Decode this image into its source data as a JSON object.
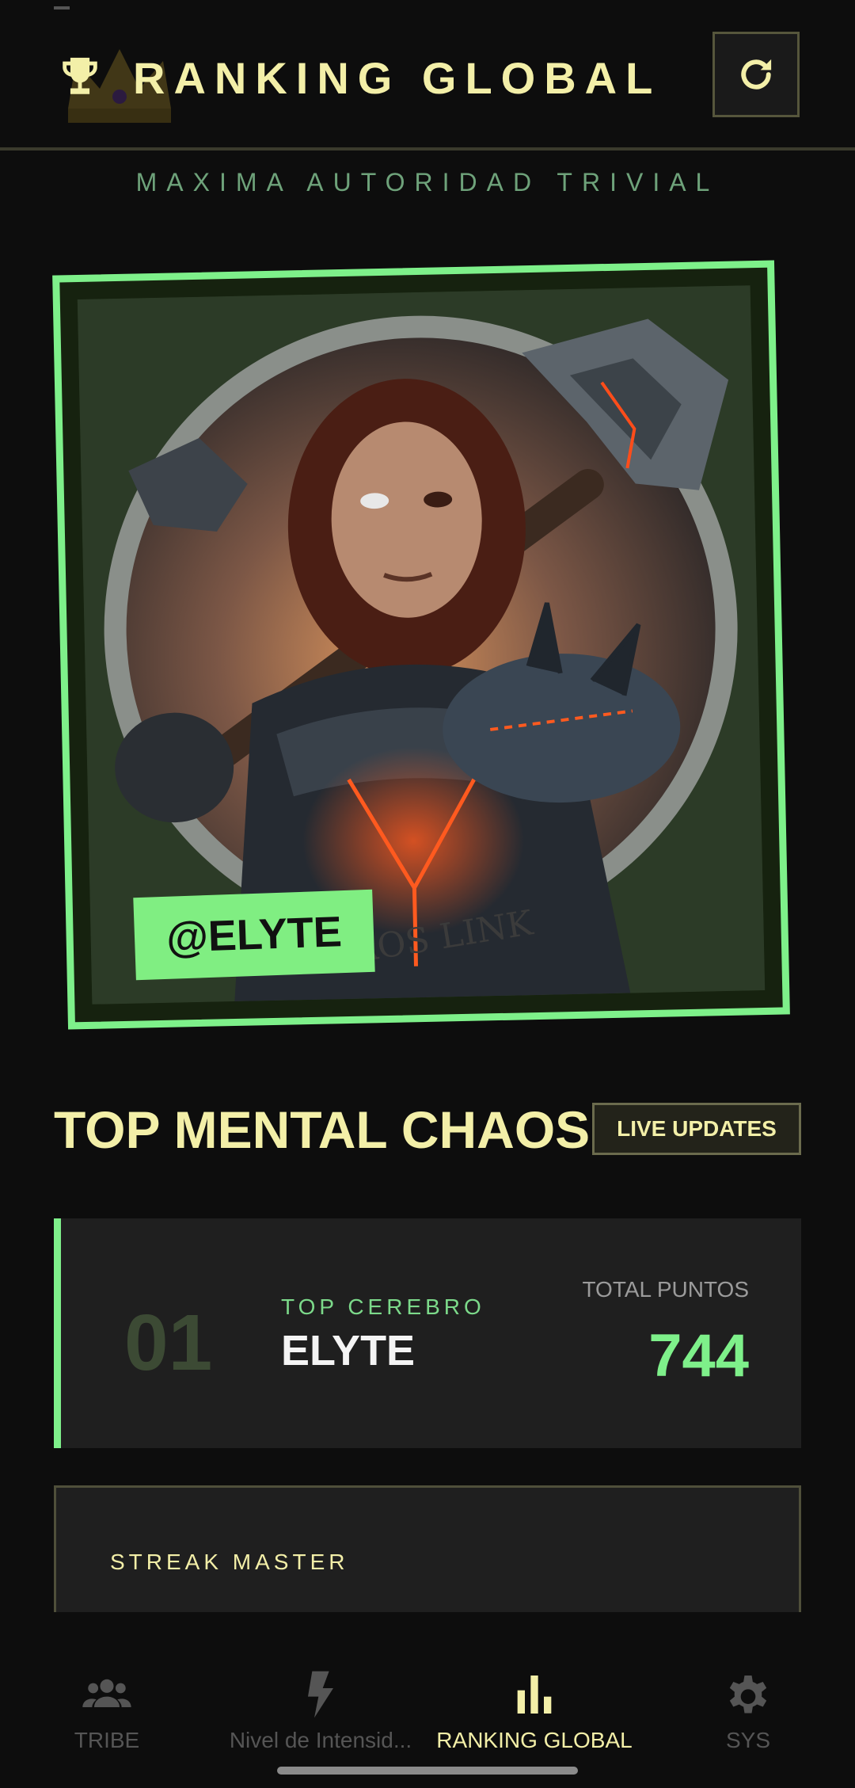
{
  "header": {
    "title": "RANKING GLOBAL",
    "subtitle": "MAXIMA AUTORIDAD TRIVIAL",
    "icons": {
      "trophy": "trophy-icon",
      "refresh": "refresh-icon",
      "crown": "crown-icon"
    }
  },
  "hero": {
    "handle": "@ELYTE",
    "art_caption": "AOS LINK"
  },
  "section": {
    "title": "TOP MENTAL CHAOS",
    "badge": "LIVE UPDATES"
  },
  "ranking": [
    {
      "rank": "01",
      "label": "TOP CEREBRO",
      "name": "ELYTE",
      "points_label": "TOTAL PUNTOS",
      "points": "744"
    }
  ],
  "streak": {
    "label": "STREAK MASTER"
  },
  "nav": {
    "items": [
      {
        "label": "TRIBE",
        "icon": "group-icon",
        "active": false
      },
      {
        "label": "Nivel de Intensid...",
        "icon": "lightning-icon",
        "active": false
      },
      {
        "label": "RANKING GLOBAL",
        "icon": "bar-chart-icon",
        "active": true
      },
      {
        "label": "SYS",
        "icon": "gear-icon",
        "active": false
      }
    ]
  },
  "colors": {
    "accent_green": "#7ef08a",
    "title_yellow": "#f3efa8",
    "background": "#0d0d0d"
  }
}
